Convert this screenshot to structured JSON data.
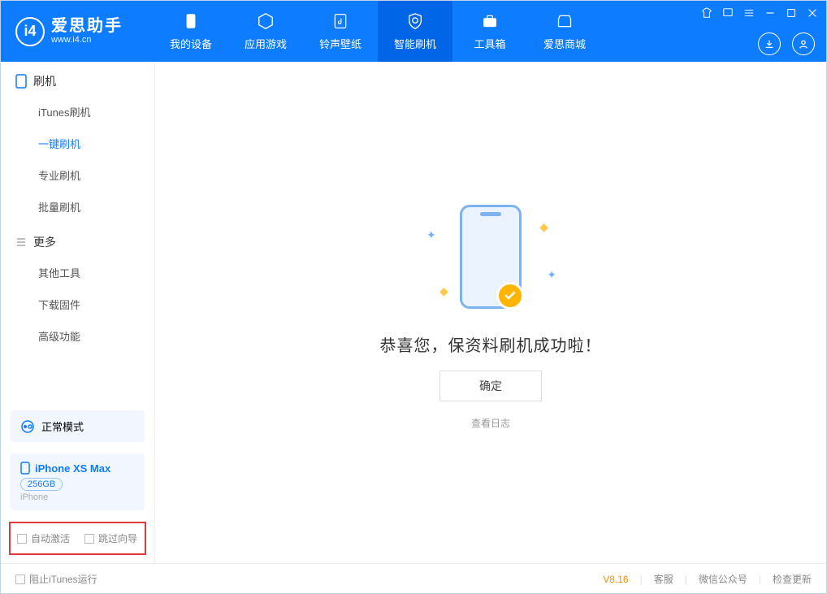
{
  "app": {
    "title": "爱思助手",
    "subtitle": "www.i4.cn"
  },
  "tabs": {
    "device": "我的设备",
    "apps": "应用游戏",
    "rings": "铃声壁纸",
    "flash": "智能刷机",
    "tools": "工具箱",
    "store": "爱思商城"
  },
  "sidebar": {
    "group1_title": "刷机",
    "group1_items": [
      "iTunes刷机",
      "一键刷机",
      "专业刷机",
      "批量刷机"
    ],
    "group2_title": "更多",
    "group2_items": [
      "其他工具",
      "下载固件",
      "高级功能"
    ]
  },
  "mode": {
    "label": "正常模式"
  },
  "device": {
    "name": "iPhone XS Max",
    "capacity": "256GB",
    "type": "iPhone"
  },
  "checkboxes": {
    "auto_activate": "自动激活",
    "skip_guide": "跳过向导"
  },
  "main": {
    "success_text": "恭喜您，保资料刷机成功啦！",
    "ok_button": "确定",
    "view_log": "查看日志"
  },
  "footer": {
    "block_itunes": "阻止iTunes运行",
    "version": "V8.16",
    "support": "客服",
    "wechat": "微信公众号",
    "check_update": "检查更新"
  }
}
